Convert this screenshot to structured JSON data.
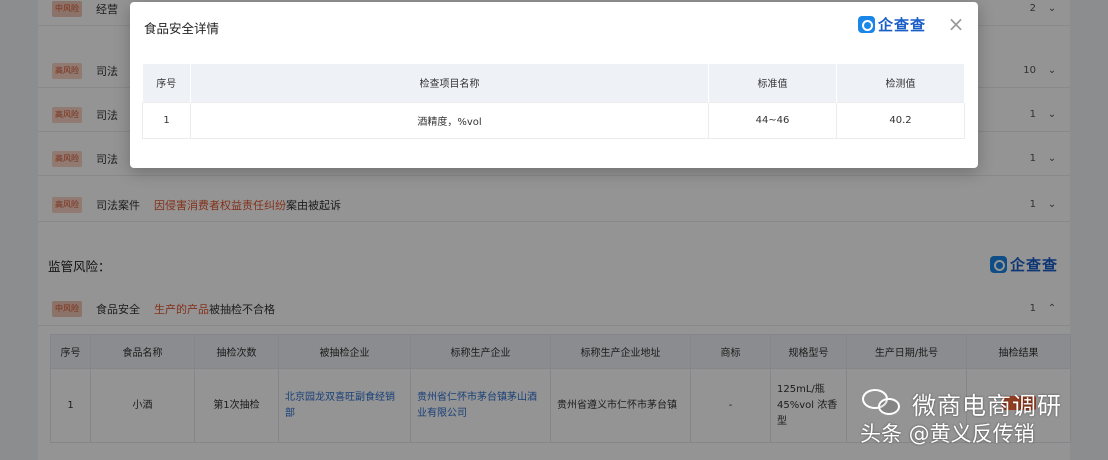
{
  "background": {
    "risk_rows": [
      {
        "tag": "中风险",
        "kind": "经营",
        "desc_hl": "",
        "desc_nm": "",
        "count": "2"
      },
      {
        "tag": "高风险",
        "kind": "司法",
        "desc_hl": "",
        "desc_nm": "",
        "count": "10"
      },
      {
        "tag": "高风险",
        "kind": "司法",
        "desc_hl": "",
        "desc_nm": "",
        "count": "1"
      },
      {
        "tag": "高风险",
        "kind": "司法",
        "desc_hl": "",
        "desc_nm": "",
        "count": "1"
      },
      {
        "tag": "高风险",
        "kind": "司法案件",
        "desc_hl": "因侵害消费者权益责任纠纷",
        "desc_nm": "案由被起诉",
        "count": "1"
      }
    ],
    "section_title": "监管风险：",
    "logo_text": "企查查",
    "food_row": {
      "tag": "中风险",
      "kind": "食品安全",
      "desc_hl": "生产的产品",
      "desc_nm": "被抽检不合格",
      "count": "1"
    },
    "table": {
      "headers": [
        "序号",
        "食品名称",
        "抽检次数",
        "被抽检企业",
        "标称生产企业",
        "标称生产企业地址",
        "商标",
        "规格型号",
        "生产日期/批号",
        "抽检结果"
      ],
      "rows": [
        [
          "1",
          "小酒",
          "第1次抽检",
          "北京园龙双喜旺副食经销部",
          "贵州省仁怀市茅台镇茅山酒业有限公司",
          "贵州省遵义市仁怀市茅台镇",
          "-",
          "125mL/瓶 45%vol 浓香型",
          "",
          ""
        ]
      ]
    }
  },
  "modal": {
    "title": "食品安全详情",
    "logo_text": "企查查",
    "close_glyph": "×",
    "table": {
      "headers": [
        "序号",
        "检查项目名称",
        "标准值",
        "检测值"
      ],
      "rows": [
        [
          "1",
          "酒精度，%vol",
          "44~46",
          "40.2"
        ]
      ]
    }
  },
  "watermark": {
    "line1": "微商电商调研",
    "line2": "头条 @黄义反传销"
  },
  "colors": {
    "accent_orange": "#e5542d",
    "link_blue": "#2a6ecf",
    "logo_blue": "#1a86e8"
  }
}
